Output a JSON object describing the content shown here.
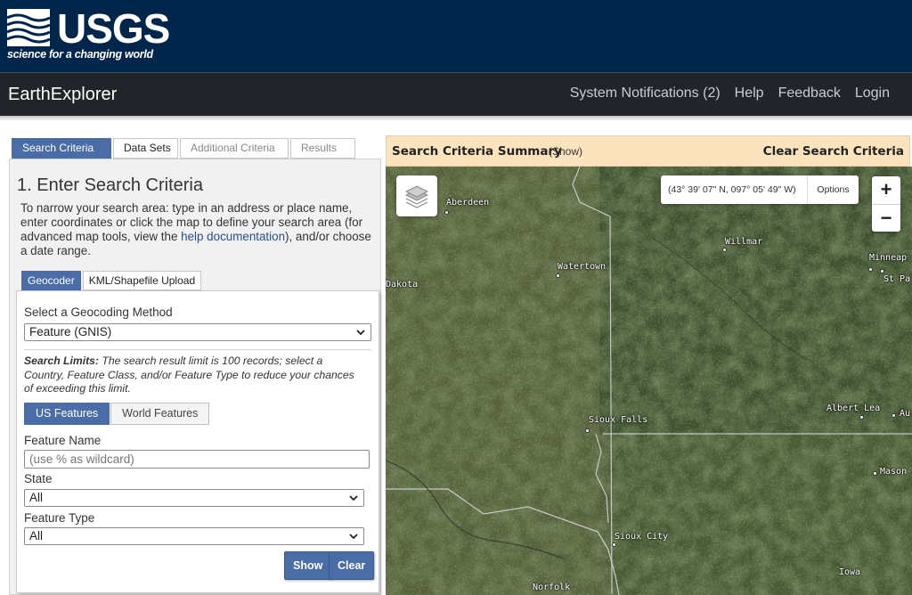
{
  "banner": {
    "logo_text": "USGS",
    "tagline": "science for a changing world",
    "bg_color": "#00264c"
  },
  "app": {
    "title": "EarthExplorer",
    "nav": [
      "System Notifications (2)",
      "Help",
      "Feedback",
      "Login"
    ]
  },
  "tabs": [
    {
      "label": "Search Criteria",
      "active": true
    },
    {
      "label": "Data Sets",
      "active": false
    },
    {
      "label": "Additional Criteria",
      "active": false
    },
    {
      "label": "Results",
      "active": false
    }
  ],
  "panel": {
    "title": "1. Enter Search Criteria",
    "desc_before": "To narrow your search area: type in an address or place name, enter coordinates or click the map to define your search area (for advanced map tools, view the ",
    "desc_link": "help documentation",
    "desc_after": "), and/or choose a date range.",
    "subtabs": [
      {
        "label": "Geocoder",
        "active": true
      },
      {
        "label": "KML/Shapefile Upload",
        "active": false
      }
    ],
    "geocoding_label": "Select a Geocoding Method",
    "geocoding_value": "Feature (GNIS)",
    "limits_bold": "Search Limits:",
    "limits_text": " The search result limit is 100 records; select a Country, Feature Class, and/or Feature Type to reduce your chances of exceeding this limit.",
    "feature_toggle": [
      {
        "label": "US Features",
        "active": true
      },
      {
        "label": "World Features",
        "active": false
      }
    ],
    "feature_name_label": "Feature Name",
    "feature_name_placeholder": "(use % as wildcard)",
    "state_label": "State",
    "state_value": "All",
    "feature_type_label": "Feature Type",
    "feature_type_value": "All",
    "show_button": "Show",
    "clear_button": "Clear"
  },
  "summary": {
    "title": "Search Criteria Summary",
    "show": "(Show)",
    "clear": "Clear Search Criteria"
  },
  "map": {
    "coords": "(43° 39' 07\" N, 097° 05' 49\" W)",
    "options_label": "Options",
    "zoom_in": "+",
    "zoom_out": "−",
    "cities": [
      {
        "name": "Aberdeen"
      },
      {
        "name": "Willmar"
      },
      {
        "name": "Watertown"
      },
      {
        "name": "Dakota"
      },
      {
        "name": "Minneap"
      },
      {
        "name": "St Pa"
      },
      {
        "name": "Sioux Falls"
      },
      {
        "name": "Albert Lea"
      },
      {
        "name": "Au"
      },
      {
        "name": "Mason"
      },
      {
        "name": "Sioux City"
      },
      {
        "name": "Iowa"
      },
      {
        "name": "Norfolk"
      }
    ]
  },
  "colors": {
    "accent": "#4a6da7",
    "summary_bg": "#fbe3bd",
    "header_bg": "#212529"
  }
}
